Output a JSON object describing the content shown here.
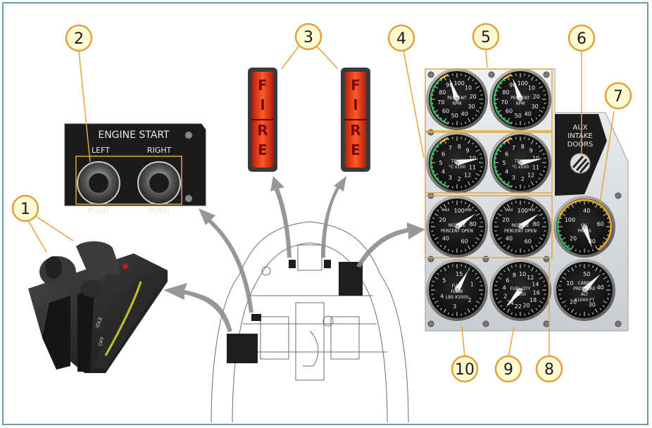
{
  "engine_start": {
    "title": "ENGINE START",
    "left_label": "LEFT",
    "right_label": "RIGHT",
    "push_left": "PUSH",
    "push_right": "PUSH"
  },
  "fire_lights": [
    {
      "letters": [
        "F",
        "I",
        "R",
        "E"
      ]
    },
    {
      "letters": [
        "F",
        "I",
        "R",
        "E"
      ]
    }
  ],
  "aux_panel": {
    "line1": "AUX",
    "line2": "INTAKE",
    "line3": "DOORS"
  },
  "throttle": {
    "idle": "IDLE",
    "off": "OFF"
  },
  "gauges": {
    "rpm_left": {
      "label1": "PERCENT",
      "label2": "RPM",
      "ticks": [
        "100",
        "10",
        "20",
        "30",
        "40",
        "50",
        "60",
        "70",
        "80",
        "90"
      ]
    },
    "rpm_right": {
      "label1": "PERCENT",
      "label2": "RPM",
      "ticks": [
        "100",
        "10",
        "20",
        "30",
        "40",
        "50",
        "60",
        "70",
        "80",
        "90"
      ]
    },
    "temp_left": {
      "label1": "TEMP",
      "label2": "°C x100",
      "ticks": [
        "8",
        "9",
        "10",
        "11",
        "12",
        "2",
        "3",
        "4",
        "5",
        "6",
        "7"
      ]
    },
    "temp_right": {
      "label1": "TEMP",
      "label2": "°C x100",
      "ticks": [
        "8",
        "9",
        "10",
        "11",
        "12",
        "2",
        "3",
        "4",
        "5",
        "6",
        "7"
      ]
    },
    "nozzle_left": {
      "max": "MAX",
      "min": "MIN",
      "label1": "NOZZLE",
      "label2": "PERCENT OPEN",
      "ticks": [
        "100",
        "80",
        "60",
        "40",
        "20"
      ]
    },
    "nozzle_right": {
      "max": "MAX",
      "min": "MIN",
      "label1": "NOZZLE",
      "label2": "PERCENT OPEN",
      "ticks": [
        "100",
        "80",
        "60",
        "40",
        "20"
      ]
    },
    "oil": {
      "label1": "OIL",
      "label2": "PRESS",
      "ticks": [
        "40",
        "60",
        "80",
        "20",
        "100"
      ]
    },
    "fuel_flow": {
      "label1": "FUEL",
      "label2": "FLOW",
      "label3": "LBS X1000",
      "ticks": [
        "15",
        "1",
        "2",
        "3",
        "4",
        "5"
      ]
    },
    "fuel_qty": {
      "label1": "FUEL QTY",
      "label2": "X100",
      "ticks": [
        "10",
        "12",
        "14",
        "16",
        "18",
        "20",
        "22",
        "24",
        "2",
        "4",
        "6",
        "8"
      ]
    },
    "cabin": {
      "label1": "CABIN",
      "label2": "PRESSURE",
      "label3": "ALT",
      "label4": "X1000 FT",
      "ticks": [
        "50",
        "40",
        "30",
        "20",
        "10"
      ]
    }
  },
  "callouts": [
    {
      "num": "1"
    },
    {
      "num": "2"
    },
    {
      "num": "3"
    },
    {
      "num": "4"
    },
    {
      "num": "5"
    },
    {
      "num": "6"
    },
    {
      "num": "7"
    },
    {
      "num": "8"
    },
    {
      "num": "9"
    },
    {
      "num": "10"
    }
  ],
  "colors": {
    "callout_fill": "#fdfbd2",
    "callout_stroke": "#e0a13a",
    "leader": "#e8a33a",
    "frame": "#6e9aa6"
  }
}
